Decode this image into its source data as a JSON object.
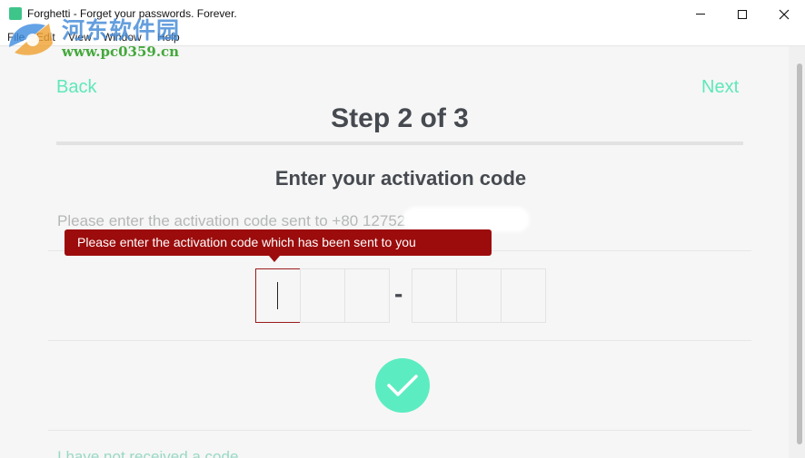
{
  "window": {
    "title": "Forghetti - Forget your passwords. Forever."
  },
  "menu": [
    "File",
    "Edit",
    "View",
    "Window",
    "Help"
  ],
  "watermark": {
    "text": "河东软件园",
    "url": "www.pc0359.cn"
  },
  "nav": {
    "back_label": "Back",
    "next_label": "Next"
  },
  "step": {
    "title": "Step 2 of 3"
  },
  "activation": {
    "heading": "Enter your activation code",
    "instruction": "Please enter the activation code sent to +80      127521.",
    "tooltip": "Please enter the activation code which has been sent to you",
    "separator": "-",
    "code_digits": [
      "",
      "",
      "",
      "",
      "",
      ""
    ],
    "resend_link": "I have not received a code"
  },
  "colors": {
    "accent": "#5cecc1",
    "link": "#5fe8b9",
    "error": "#9c0c0c",
    "heading": "#464a50",
    "background": "#f5f6f5"
  }
}
